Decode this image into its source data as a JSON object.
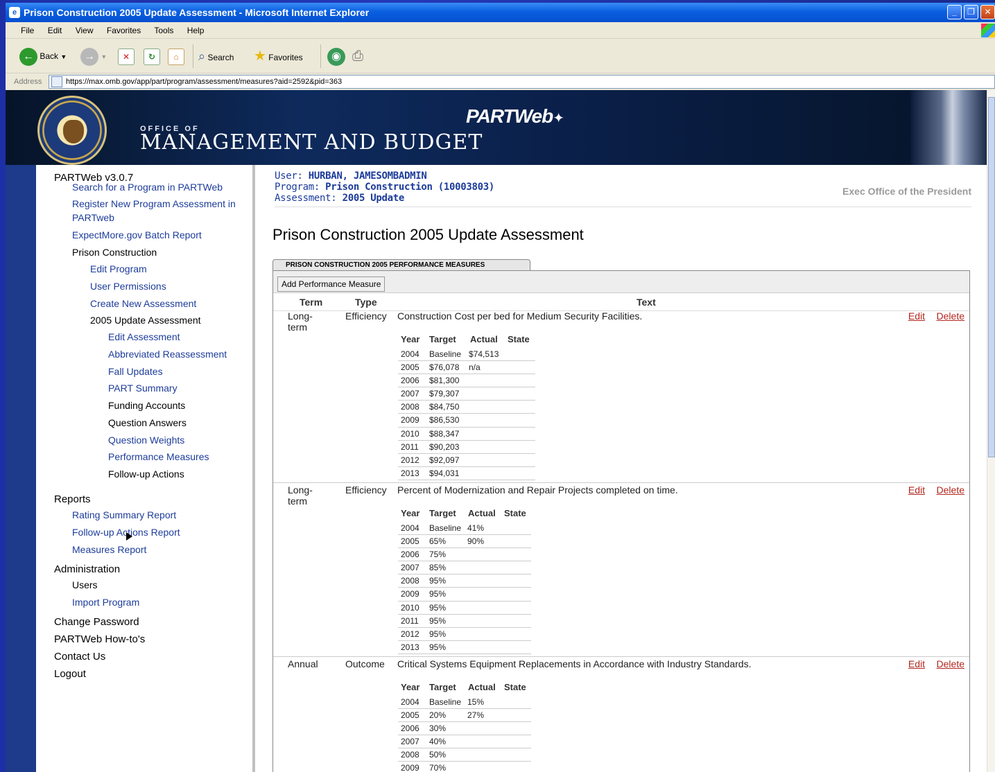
{
  "window": {
    "title": "Prison Construction 2005 Update Assessment - Microsoft Internet Explorer"
  },
  "menu": [
    "File",
    "Edit",
    "View",
    "Favorites",
    "Tools",
    "Help"
  ],
  "toolbar": {
    "back": "Back",
    "search": "Search",
    "favorites": "Favorites"
  },
  "address": {
    "label": "Address",
    "url": "https://max.omb.gov/app/part/program/assessment/measures?aid=2592&pid=363"
  },
  "banner": {
    "office_of": "OFFICE OF",
    "agency": "MANAGEMENT AND BUDGET",
    "product": "PARTWeb",
    "seal_text": "EXECUTIVE OFFICE OF THE PRESIDENT • UNITED STATES"
  },
  "sidebar": {
    "version": "PARTWeb v3.0.7",
    "items": [
      {
        "label": "Search for a Program in PARTWeb",
        "style": "link"
      },
      {
        "label": "Register New Program Assessment in",
        "style": "link"
      },
      {
        "label": "PARTweb",
        "style": "link"
      },
      {
        "label": "ExpectMore.gov Batch Report",
        "style": "link"
      },
      {
        "label": "Prison Construction",
        "style": "dark"
      },
      {
        "label": "Edit Program",
        "style": "link"
      },
      {
        "label": "User Permissions",
        "style": "link"
      },
      {
        "label": "Create New Assessment",
        "style": "link"
      },
      {
        "label": "2005 Update Assessment",
        "style": "dark"
      },
      {
        "label": "Edit Assessment",
        "style": "link"
      },
      {
        "label": "Abbreviated Reassessment",
        "style": "link"
      },
      {
        "label": "Fall Updates",
        "style": "link"
      },
      {
        "label": "PART Summary",
        "style": "link"
      },
      {
        "label": "Funding Accounts",
        "style": "dark"
      },
      {
        "label": "Question Answers",
        "style": "dark"
      },
      {
        "label": "Question Weights",
        "style": "link"
      },
      {
        "label": "Performance Measures",
        "style": "link"
      },
      {
        "label": "Follow-up Actions",
        "style": "dark"
      },
      {
        "label": "Reports",
        "style": "head"
      },
      {
        "label": "Rating Summary Report",
        "style": "link"
      },
      {
        "label": "Follow-up Actions Report",
        "style": "link"
      },
      {
        "label": "Measures Report",
        "style": "link"
      },
      {
        "label": "Administration",
        "style": "head"
      },
      {
        "label": "Users",
        "style": "dark"
      },
      {
        "label": "Import Program",
        "style": "link"
      },
      {
        "label": "Change Password",
        "style": "head"
      },
      {
        "label": "PARTWeb How-to's",
        "style": "head"
      },
      {
        "label": "Contact Us",
        "style": "head"
      },
      {
        "label": "Logout",
        "style": "head"
      }
    ]
  },
  "context": {
    "user_label": "User:",
    "user": "HURBAN, JAMESOMBADMIN",
    "program_label": "Program:",
    "program": "Prison Construction (10003803)",
    "assessment_label": "Assessment:",
    "assessment": "2005 Update",
    "agency": "Exec Office of the President"
  },
  "page": {
    "title": "Prison Construction 2005 Update Assessment",
    "tab": "PRISON CONSTRUCTION 2005 PERFORMANCE MEASURES",
    "add_button": "Add Performance Measure",
    "columns": {
      "term": "Term",
      "type": "Type",
      "text": "Text"
    },
    "sub_columns": {
      "year": "Year",
      "target": "Target",
      "actual": "Actual",
      "state": "State"
    },
    "edit_label": "Edit",
    "delete_label": "Delete"
  },
  "measures": [
    {
      "term": "Long-term",
      "type": "Efficiency",
      "text": "Construction Cost per bed for Medium Security Facilities.",
      "rows": [
        {
          "year": "2004",
          "target": "Baseline",
          "actual": "$74,513",
          "state": ""
        },
        {
          "year": "2005",
          "target": "$76,078",
          "actual": "n/a",
          "state": ""
        },
        {
          "year": "2006",
          "target": "$81,300",
          "actual": "",
          "state": ""
        },
        {
          "year": "2007",
          "target": "$79,307",
          "actual": "",
          "state": ""
        },
        {
          "year": "2008",
          "target": "$84,750",
          "actual": "",
          "state": ""
        },
        {
          "year": "2009",
          "target": "$86,530",
          "actual": "",
          "state": ""
        },
        {
          "year": "2010",
          "target": "$88,347",
          "actual": "",
          "state": ""
        },
        {
          "year": "2011",
          "target": "$90,203",
          "actual": "",
          "state": ""
        },
        {
          "year": "2012",
          "target": "$92,097",
          "actual": "",
          "state": ""
        },
        {
          "year": "2013",
          "target": "$94,031",
          "actual": "",
          "state": ""
        }
      ]
    },
    {
      "term": "Long-term",
      "type": "Efficiency",
      "text": "Percent of Modernization and Repair Projects completed on time.",
      "rows": [
        {
          "year": "2004",
          "target": "Baseline",
          "actual": "41%",
          "state": ""
        },
        {
          "year": "2005",
          "target": "65%",
          "actual": "90%",
          "state": ""
        },
        {
          "year": "2006",
          "target": "75%",
          "actual": "",
          "state": ""
        },
        {
          "year": "2007",
          "target": "85%",
          "actual": "",
          "state": ""
        },
        {
          "year": "2008",
          "target": "95%",
          "actual": "",
          "state": ""
        },
        {
          "year": "2009",
          "target": "95%",
          "actual": "",
          "state": ""
        },
        {
          "year": "2010",
          "target": "95%",
          "actual": "",
          "state": ""
        },
        {
          "year": "2011",
          "target": "95%",
          "actual": "",
          "state": ""
        },
        {
          "year": "2012",
          "target": "95%",
          "actual": "",
          "state": ""
        },
        {
          "year": "2013",
          "target": "95%",
          "actual": "",
          "state": ""
        }
      ]
    },
    {
      "term": "Annual",
      "type": "Outcome",
      "text": "Critical Systems Equipment Replacements in Accordance with Industry Standards.",
      "rows": [
        {
          "year": "2004",
          "target": "Baseline",
          "actual": "15%",
          "state": ""
        },
        {
          "year": "2005",
          "target": "20%",
          "actual": "27%",
          "state": ""
        },
        {
          "year": "2006",
          "target": "30%",
          "actual": "",
          "state": ""
        },
        {
          "year": "2007",
          "target": "40%",
          "actual": "",
          "state": ""
        },
        {
          "year": "2008",
          "target": "50%",
          "actual": "",
          "state": ""
        },
        {
          "year": "2009",
          "target": "70%",
          "actual": "",
          "state": ""
        }
      ]
    }
  ],
  "colors": {
    "link": "#1d3c9a",
    "action": "#b3261e",
    "xp_title": "#0a5fe0"
  }
}
